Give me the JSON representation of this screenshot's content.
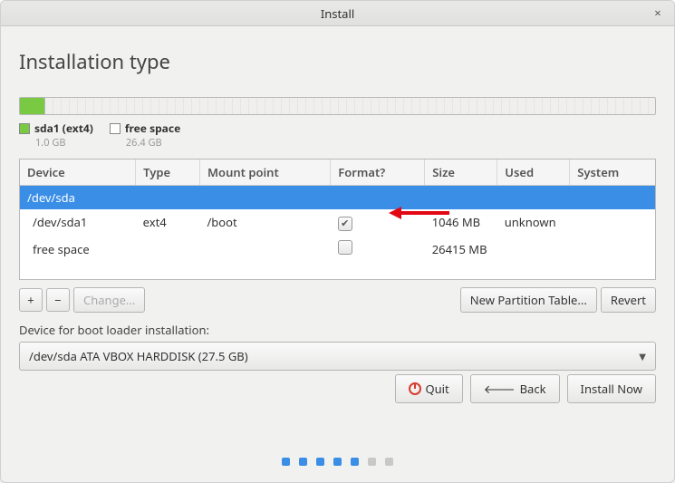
{
  "window": {
    "title": "Install",
    "close_label": "×"
  },
  "heading": "Installation type",
  "legend": {
    "sda1": {
      "label": "sda1 (ext4)",
      "size": "1.0 GB"
    },
    "free": {
      "label": "free space",
      "size": "26.4 GB"
    }
  },
  "columns": {
    "device": "Device",
    "type": "Type",
    "mount": "Mount point",
    "format": "Format?",
    "size": "Size",
    "used": "Used",
    "system": "System"
  },
  "rows": {
    "disk": {
      "device": "/dev/sda"
    },
    "r1": {
      "device": "/dev/sda1",
      "type": "ext4",
      "mount": "/boot",
      "format_checked": true,
      "size": "1046 MB",
      "used": "unknown",
      "system": ""
    },
    "r2": {
      "device": "free space",
      "type": "",
      "mount": "",
      "format_checked": false,
      "size": "26415 MB",
      "used": "",
      "system": ""
    }
  },
  "buttons": {
    "add": "+",
    "remove": "−",
    "change": "Change...",
    "new_table": "New Partition Table...",
    "revert": "Revert",
    "quit": "Quit",
    "back": "Back",
    "install": "Install Now",
    "back_arrow": "🡐"
  },
  "bootloader": {
    "label": "Device for boot loader installation:",
    "value": "/dev/sda   ATA VBOX HARDDISK (27.5 GB)"
  }
}
